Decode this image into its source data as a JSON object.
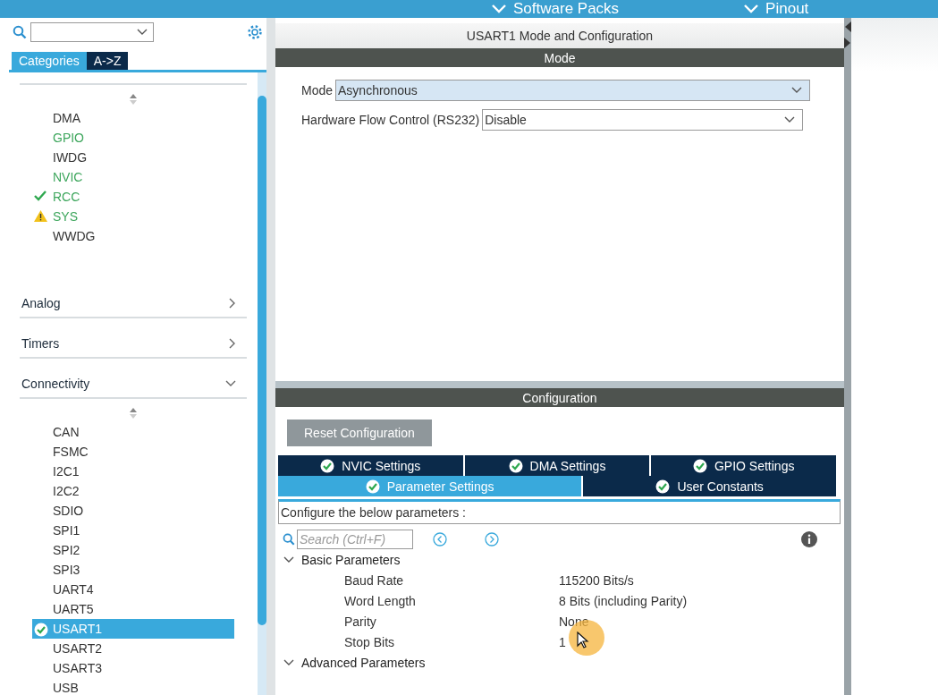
{
  "top_bar": {
    "menus": [
      {
        "label": "Software Packs"
      },
      {
        "label": "Pinout"
      }
    ]
  },
  "sidebar": {
    "tabs": [
      {
        "label": "Categories",
        "selected": true
      },
      {
        "label": "A->Z",
        "selected": false
      }
    ],
    "system_core_items": [
      {
        "label": "DMA",
        "configured": false,
        "checked": false,
        "warning": false,
        "selected": false
      },
      {
        "label": "GPIO",
        "configured": true,
        "checked": false,
        "warning": false,
        "selected": false
      },
      {
        "label": "IWDG",
        "configured": false,
        "checked": false,
        "warning": false,
        "selected": false
      },
      {
        "label": "NVIC",
        "configured": true,
        "checked": false,
        "warning": false,
        "selected": false
      },
      {
        "label": "RCC",
        "configured": true,
        "checked": true,
        "warning": false,
        "selected": false
      },
      {
        "label": "SYS",
        "configured": true,
        "checked": false,
        "warning": true,
        "selected": false
      },
      {
        "label": "WWDG",
        "configured": false,
        "checked": false,
        "warning": false,
        "selected": false
      }
    ],
    "categories": [
      {
        "label": "Analog",
        "expanded": false
      },
      {
        "label": "Timers",
        "expanded": false
      },
      {
        "label": "Connectivity",
        "expanded": true
      }
    ],
    "connectivity_items": [
      {
        "label": "CAN",
        "configured": false,
        "checked": false,
        "warning": false,
        "selected": false
      },
      {
        "label": "FSMC",
        "configured": false,
        "checked": false,
        "warning": false,
        "selected": false
      },
      {
        "label": "I2C1",
        "configured": false,
        "checked": false,
        "warning": false,
        "selected": false
      },
      {
        "label": "I2C2",
        "configured": false,
        "checked": false,
        "warning": false,
        "selected": false
      },
      {
        "label": "SDIO",
        "configured": false,
        "checked": false,
        "warning": false,
        "selected": false
      },
      {
        "label": "SPI1",
        "configured": false,
        "checked": false,
        "warning": false,
        "selected": false
      },
      {
        "label": "SPI2",
        "configured": false,
        "checked": false,
        "warning": false,
        "selected": false
      },
      {
        "label": "SPI3",
        "configured": false,
        "checked": false,
        "warning": false,
        "selected": false
      },
      {
        "label": "UART4",
        "configured": false,
        "checked": false,
        "warning": false,
        "selected": false
      },
      {
        "label": "UART5",
        "configured": false,
        "checked": false,
        "warning": false,
        "selected": false
      },
      {
        "label": "USART1",
        "configured": false,
        "checked": true,
        "warning": false,
        "selected": true
      },
      {
        "label": "USART2",
        "configured": false,
        "checked": false,
        "warning": false,
        "selected": false
      },
      {
        "label": "USART3",
        "configured": false,
        "checked": false,
        "warning": false,
        "selected": false
      },
      {
        "label": "USB",
        "configured": false,
        "checked": false,
        "warning": false,
        "selected": false
      }
    ]
  },
  "panel": {
    "title": "USART1 Mode and Configuration",
    "mode_header": "Mode",
    "mode_fields": [
      {
        "label": "Mode",
        "value": "Asynchronous",
        "highlighted": true
      },
      {
        "label": "Hardware Flow Control (RS232)",
        "value": "Disable",
        "highlighted": false
      }
    ],
    "configuration_header": "Configuration",
    "reset_button": "Reset Configuration",
    "tab_rows": [
      [
        {
          "label": "NVIC Settings",
          "selected": false
        },
        {
          "label": "DMA Settings",
          "selected": false
        },
        {
          "label": "GPIO Settings",
          "selected": false
        }
      ],
      [
        {
          "label": "Parameter Settings",
          "selected": true
        },
        {
          "label": "User Constants",
          "selected": false
        }
      ]
    ],
    "description": "Configure the below parameters :",
    "search": {
      "placeholder": "Search (Ctrl+F)"
    },
    "groups": [
      {
        "label": "Basic Parameters",
        "expanded": true,
        "params": [
          {
            "name": "Baud Rate",
            "value": "115200 Bits/s"
          },
          {
            "name": "Word Length",
            "value": "8 Bits (including Parity)"
          },
          {
            "name": "Parity",
            "value": "None"
          },
          {
            "name": "Stop Bits",
            "value": "1"
          }
        ]
      },
      {
        "label": "Advanced Parameters",
        "expanded": true
      }
    ]
  }
}
